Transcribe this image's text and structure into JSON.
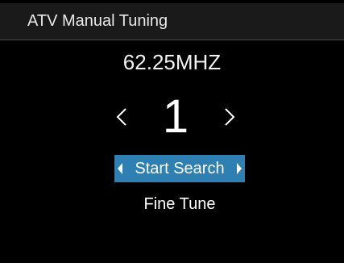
{
  "title": "ATV Manual Tuning",
  "frequency": "62.25MHZ",
  "channel": {
    "number": "1",
    "prev_icon": "chevron-left-icon",
    "next_icon": "chevron-right-icon"
  },
  "menu": {
    "start_search": "Start Search",
    "fine_tune": "Fine Tune"
  },
  "colors": {
    "background": "#000000",
    "highlight": "#2e7fb2",
    "text": "#ffffff"
  }
}
